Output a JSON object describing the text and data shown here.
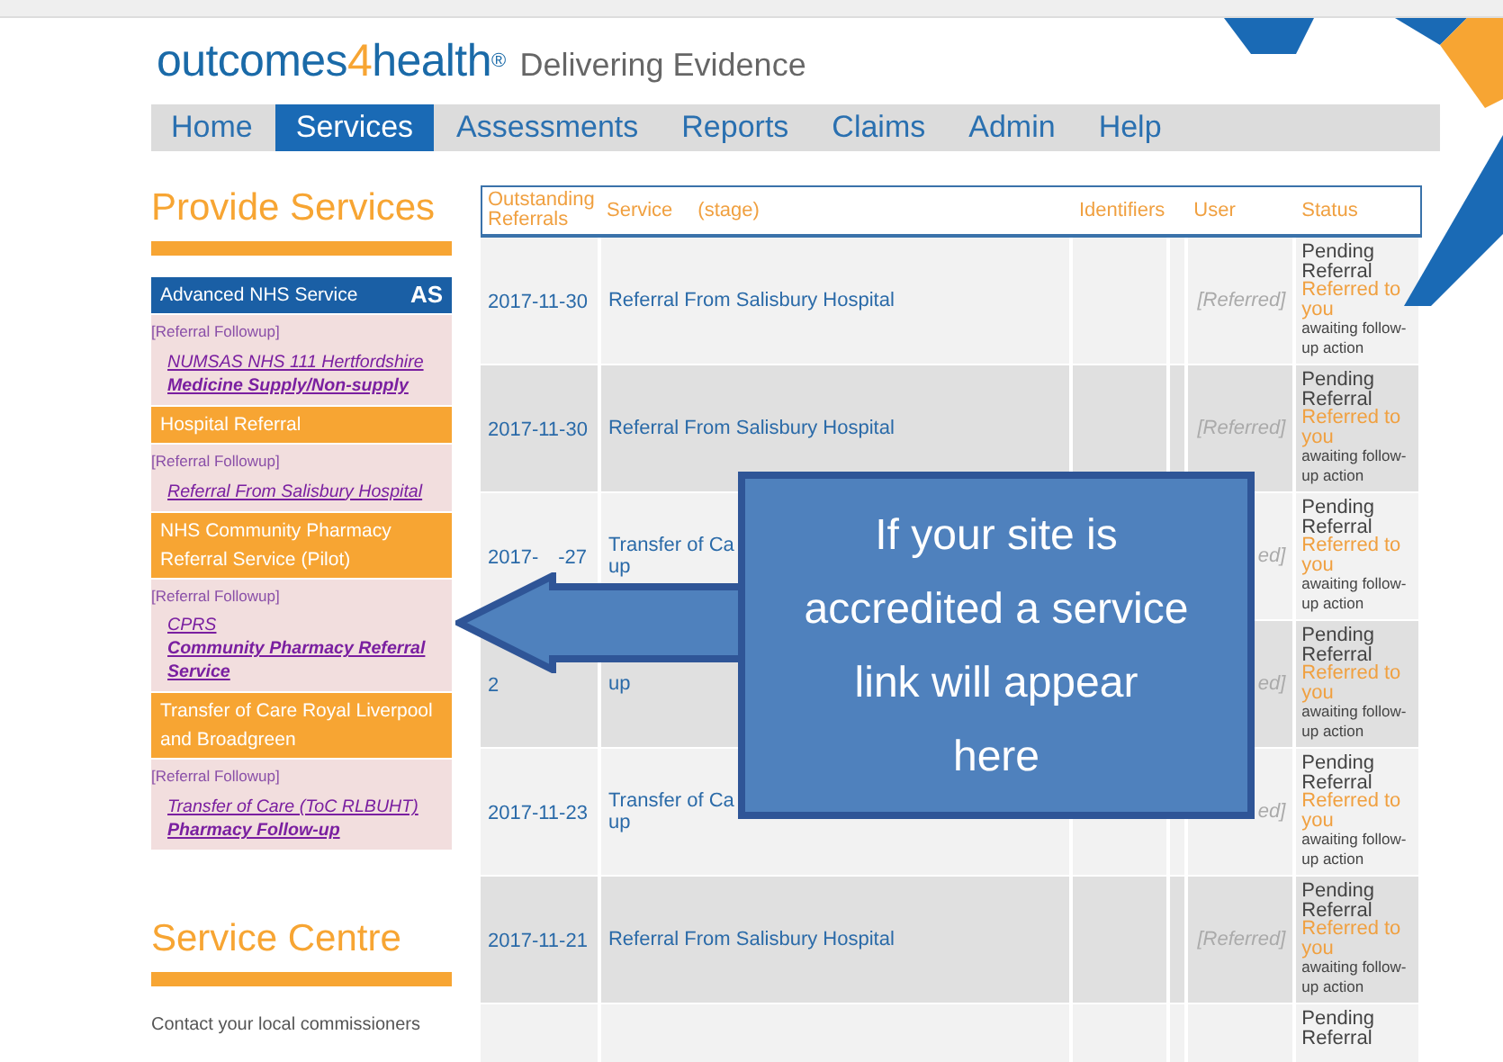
{
  "logo": {
    "brand_start": "outcomes",
    "brand_digit": "4",
    "brand_end": "health",
    "registered": "®",
    "tagline": "Delivering Evidence"
  },
  "nav": [
    {
      "label": "Home",
      "selected": false
    },
    {
      "label": "Services",
      "selected": true
    },
    {
      "label": "Assessments",
      "selected": false
    },
    {
      "label": "Reports",
      "selected": false
    },
    {
      "label": "Claims",
      "selected": false
    },
    {
      "label": "Admin",
      "selected": false
    },
    {
      "label": "Help",
      "selected": false
    }
  ],
  "sidebar": {
    "title": "Provide Services",
    "services": [
      {
        "kind": "advanced",
        "name": "Advanced NHS Service",
        "badge": "AS",
        "stage": "[Referral Followup]",
        "links": [
          {
            "text": "NUMSAS NHS 111 Hertfordshire",
            "bold": false
          },
          {
            "text": "Medicine Supply/Non-supply",
            "bold": true
          }
        ]
      },
      {
        "kind": "standard",
        "name": "Hospital Referral",
        "stage": "[Referral Followup]",
        "links": [
          {
            "text": "Referral From Salisbury Hospital",
            "bold": false
          }
        ]
      },
      {
        "kind": "standard",
        "name": "NHS Community Pharmacy Referral Service (Pilot)",
        "stage": "[Referral Followup]",
        "links": [
          {
            "text": "CPRS",
            "bold": false
          },
          {
            "text": "Community Pharmacy Referral Service",
            "bold": true
          }
        ]
      },
      {
        "kind": "standard",
        "name": "Transfer of Care Royal Liverpool and Broadgreen",
        "stage": "[Referral Followup]",
        "links": [
          {
            "text": "Transfer of Care (ToC RLBUHT)",
            "bold": false
          },
          {
            "text": "Pharmacy Follow-up",
            "bold": true
          }
        ]
      }
    ]
  },
  "service_centre": {
    "title": "Service Centre",
    "lines": [
      "Contact your local commissioners"
    ]
  },
  "table": {
    "columns": [
      "Outstanding Referrals",
      "Service",
      "(stage)",
      "Identifiers",
      "User",
      "Status"
    ],
    "rows": [
      {
        "date": [
          "2017-11-30"
        ],
        "service": [
          "Referral From Salisbury Hospital"
        ],
        "user": "[Referred]",
        "status": {
          "state": "Pending Referral",
          "note": "Referred to you",
          "detail": "awaiting follow-up action"
        }
      },
      {
        "date": [
          "2017-11-30"
        ],
        "service": [
          "Referral From Salisbury Hospital"
        ],
        "user": "[Referred]",
        "status": {
          "state": "Pending Referral",
          "note": "Referred to you",
          "detail": "awaiting follow-up action"
        }
      },
      {
        "date": [
          "2017-",
          "-27"
        ],
        "service": [
          "Transfer of Ca",
          "up"
        ],
        "user": "ed]",
        "status": {
          "state": "Pending Referral",
          "note": "Referred to you",
          "detail": "awaiting follow-up action"
        }
      },
      {
        "date": [
          "2"
        ],
        "service": [
          "up"
        ],
        "user": "ed]",
        "status": {
          "state": "Pending Referral",
          "note": "Referred to you",
          "detail": "awaiting follow-up action"
        }
      },
      {
        "date": [
          "2017-11-23"
        ],
        "service": [
          "Transfer of Ca",
          "up"
        ],
        "user": "ed]",
        "status": {
          "state": "Pending Referral",
          "note": "Referred to you",
          "detail": "awaiting follow-up action"
        }
      },
      {
        "date": [
          "2017-11-21"
        ],
        "service": [
          "Referral From Salisbury Hospital"
        ],
        "user": "[Referred]",
        "status": {
          "state": "Pending Referral",
          "note": "Referred to you",
          "detail": "awaiting follow-up action"
        }
      },
      {
        "date": [],
        "service": [],
        "user": "",
        "status": {
          "state": "Pending Referral"
        }
      }
    ]
  },
  "callout": {
    "lines": [
      "If your site is",
      "accredited a service",
      "link will appear",
      "here"
    ]
  }
}
